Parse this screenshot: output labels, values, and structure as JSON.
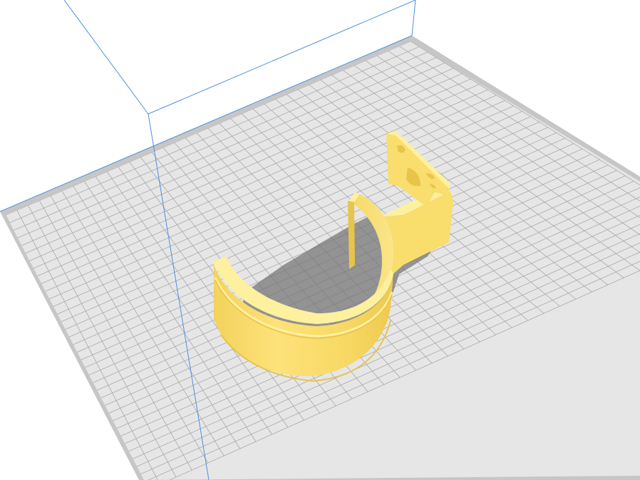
{
  "app": {
    "window_title": ""
  },
  "viewport": {
    "background": "#ffffff",
    "build_plate_color": "#e6e6e6",
    "build_plate_border_color": "#c6c6c6",
    "grid_line_color": "#a9a9a9",
    "build_volume_color": "#4d8fe0",
    "shadow_color": "#777777"
  },
  "model": {
    "color": "#f9dd6d",
    "highlight_color": "#fdf09f",
    "dark_color": "#e7c44b",
    "shape": "pipe-clamp-bracket"
  }
}
